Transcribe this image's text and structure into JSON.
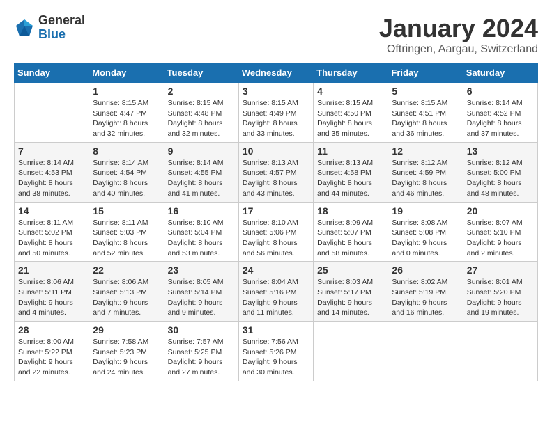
{
  "logo": {
    "general": "General",
    "blue": "Blue"
  },
  "title": "January 2024",
  "location": "Oftringen, Aargau, Switzerland",
  "weekdays": [
    "Sunday",
    "Monday",
    "Tuesday",
    "Wednesday",
    "Thursday",
    "Friday",
    "Saturday"
  ],
  "weeks": [
    [
      {
        "day": "",
        "sunrise": "",
        "sunset": "",
        "daylight": ""
      },
      {
        "day": "1",
        "sunrise": "Sunrise: 8:15 AM",
        "sunset": "Sunset: 4:47 PM",
        "daylight": "Daylight: 8 hours and 32 minutes."
      },
      {
        "day": "2",
        "sunrise": "Sunrise: 8:15 AM",
        "sunset": "Sunset: 4:48 PM",
        "daylight": "Daylight: 8 hours and 32 minutes."
      },
      {
        "day": "3",
        "sunrise": "Sunrise: 8:15 AM",
        "sunset": "Sunset: 4:49 PM",
        "daylight": "Daylight: 8 hours and 33 minutes."
      },
      {
        "day": "4",
        "sunrise": "Sunrise: 8:15 AM",
        "sunset": "Sunset: 4:50 PM",
        "daylight": "Daylight: 8 hours and 35 minutes."
      },
      {
        "day": "5",
        "sunrise": "Sunrise: 8:15 AM",
        "sunset": "Sunset: 4:51 PM",
        "daylight": "Daylight: 8 hours and 36 minutes."
      },
      {
        "day": "6",
        "sunrise": "Sunrise: 8:14 AM",
        "sunset": "Sunset: 4:52 PM",
        "daylight": "Daylight: 8 hours and 37 minutes."
      }
    ],
    [
      {
        "day": "7",
        "sunrise": "Sunrise: 8:14 AM",
        "sunset": "Sunset: 4:53 PM",
        "daylight": "Daylight: 8 hours and 38 minutes."
      },
      {
        "day": "8",
        "sunrise": "Sunrise: 8:14 AM",
        "sunset": "Sunset: 4:54 PM",
        "daylight": "Daylight: 8 hours and 40 minutes."
      },
      {
        "day": "9",
        "sunrise": "Sunrise: 8:14 AM",
        "sunset": "Sunset: 4:55 PM",
        "daylight": "Daylight: 8 hours and 41 minutes."
      },
      {
        "day": "10",
        "sunrise": "Sunrise: 8:13 AM",
        "sunset": "Sunset: 4:57 PM",
        "daylight": "Daylight: 8 hours and 43 minutes."
      },
      {
        "day": "11",
        "sunrise": "Sunrise: 8:13 AM",
        "sunset": "Sunset: 4:58 PM",
        "daylight": "Daylight: 8 hours and 44 minutes."
      },
      {
        "day": "12",
        "sunrise": "Sunrise: 8:12 AM",
        "sunset": "Sunset: 4:59 PM",
        "daylight": "Daylight: 8 hours and 46 minutes."
      },
      {
        "day": "13",
        "sunrise": "Sunrise: 8:12 AM",
        "sunset": "Sunset: 5:00 PM",
        "daylight": "Daylight: 8 hours and 48 minutes."
      }
    ],
    [
      {
        "day": "14",
        "sunrise": "Sunrise: 8:11 AM",
        "sunset": "Sunset: 5:02 PM",
        "daylight": "Daylight: 8 hours and 50 minutes."
      },
      {
        "day": "15",
        "sunrise": "Sunrise: 8:11 AM",
        "sunset": "Sunset: 5:03 PM",
        "daylight": "Daylight: 8 hours and 52 minutes."
      },
      {
        "day": "16",
        "sunrise": "Sunrise: 8:10 AM",
        "sunset": "Sunset: 5:04 PM",
        "daylight": "Daylight: 8 hours and 53 minutes."
      },
      {
        "day": "17",
        "sunrise": "Sunrise: 8:10 AM",
        "sunset": "Sunset: 5:06 PM",
        "daylight": "Daylight: 8 hours and 56 minutes."
      },
      {
        "day": "18",
        "sunrise": "Sunrise: 8:09 AM",
        "sunset": "Sunset: 5:07 PM",
        "daylight": "Daylight: 8 hours and 58 minutes."
      },
      {
        "day": "19",
        "sunrise": "Sunrise: 8:08 AM",
        "sunset": "Sunset: 5:08 PM",
        "daylight": "Daylight: 9 hours and 0 minutes."
      },
      {
        "day": "20",
        "sunrise": "Sunrise: 8:07 AM",
        "sunset": "Sunset: 5:10 PM",
        "daylight": "Daylight: 9 hours and 2 minutes."
      }
    ],
    [
      {
        "day": "21",
        "sunrise": "Sunrise: 8:06 AM",
        "sunset": "Sunset: 5:11 PM",
        "daylight": "Daylight: 9 hours and 4 minutes."
      },
      {
        "day": "22",
        "sunrise": "Sunrise: 8:06 AM",
        "sunset": "Sunset: 5:13 PM",
        "daylight": "Daylight: 9 hours and 7 minutes."
      },
      {
        "day": "23",
        "sunrise": "Sunrise: 8:05 AM",
        "sunset": "Sunset: 5:14 PM",
        "daylight": "Daylight: 9 hours and 9 minutes."
      },
      {
        "day": "24",
        "sunrise": "Sunrise: 8:04 AM",
        "sunset": "Sunset: 5:16 PM",
        "daylight": "Daylight: 9 hours and 11 minutes."
      },
      {
        "day": "25",
        "sunrise": "Sunrise: 8:03 AM",
        "sunset": "Sunset: 5:17 PM",
        "daylight": "Daylight: 9 hours and 14 minutes."
      },
      {
        "day": "26",
        "sunrise": "Sunrise: 8:02 AM",
        "sunset": "Sunset: 5:19 PM",
        "daylight": "Daylight: 9 hours and 16 minutes."
      },
      {
        "day": "27",
        "sunrise": "Sunrise: 8:01 AM",
        "sunset": "Sunset: 5:20 PM",
        "daylight": "Daylight: 9 hours and 19 minutes."
      }
    ],
    [
      {
        "day": "28",
        "sunrise": "Sunrise: 8:00 AM",
        "sunset": "Sunset: 5:22 PM",
        "daylight": "Daylight: 9 hours and 22 minutes."
      },
      {
        "day": "29",
        "sunrise": "Sunrise: 7:58 AM",
        "sunset": "Sunset: 5:23 PM",
        "daylight": "Daylight: 9 hours and 24 minutes."
      },
      {
        "day": "30",
        "sunrise": "Sunrise: 7:57 AM",
        "sunset": "Sunset: 5:25 PM",
        "daylight": "Daylight: 9 hours and 27 minutes."
      },
      {
        "day": "31",
        "sunrise": "Sunrise: 7:56 AM",
        "sunset": "Sunset: 5:26 PM",
        "daylight": "Daylight: 9 hours and 30 minutes."
      },
      {
        "day": "",
        "sunrise": "",
        "sunset": "",
        "daylight": ""
      },
      {
        "day": "",
        "sunrise": "",
        "sunset": "",
        "daylight": ""
      },
      {
        "day": "",
        "sunrise": "",
        "sunset": "",
        "daylight": ""
      }
    ]
  ]
}
